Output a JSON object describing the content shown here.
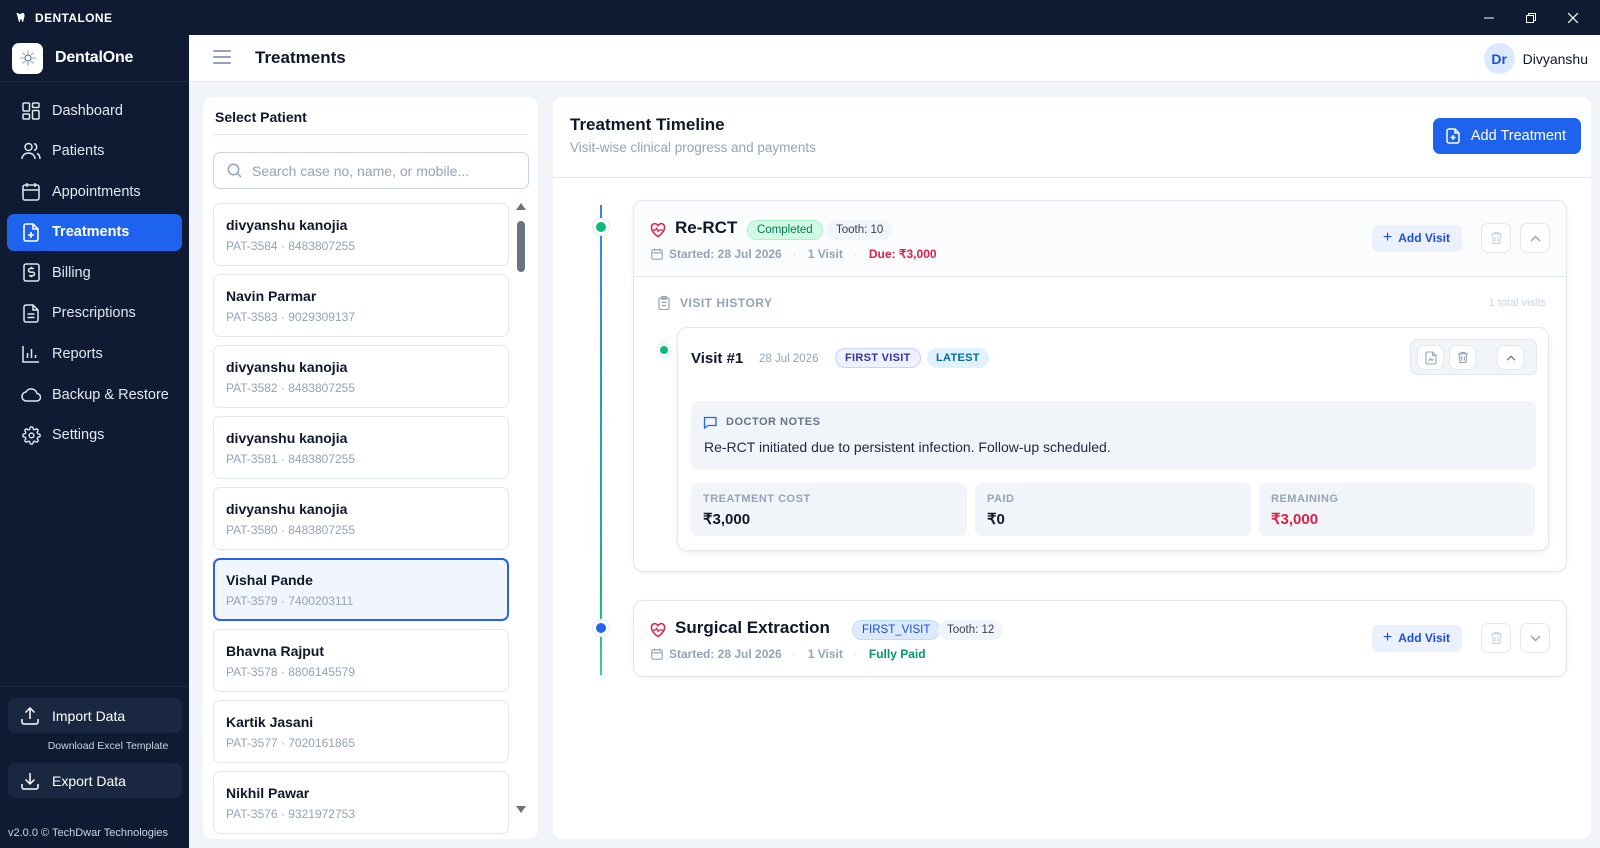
{
  "window": {
    "title": "DENTALONE",
    "controls": [
      "minimize-icon",
      "restore-icon",
      "close-icon"
    ]
  },
  "sidebar": {
    "brand": "DentalOne",
    "items": [
      {
        "label": "Dashboard",
        "icon": "dashboard-icon"
      },
      {
        "label": "Patients",
        "icon": "users-icon"
      },
      {
        "label": "Appointments",
        "icon": "calendar-icon"
      },
      {
        "label": "Treatments",
        "icon": "file-plus-icon",
        "active": true
      },
      {
        "label": "Billing",
        "icon": "billing-icon"
      },
      {
        "label": "Prescriptions",
        "icon": "document-icon"
      },
      {
        "label": "Reports",
        "icon": "bar-chart-icon"
      },
      {
        "label": "Backup & Restore",
        "icon": "cloud-icon"
      },
      {
        "label": "Settings",
        "icon": "gear-icon"
      }
    ],
    "import_label": "Import Data",
    "download_template": "Download Excel Template",
    "export_label": "Export Data",
    "version": "v2.0.0 © TechDwar Technologies"
  },
  "header": {
    "title": "Treatments",
    "user_initials": "Dr",
    "user_name": "Divyanshu"
  },
  "patients": {
    "title": "Select Patient",
    "search_placeholder": "Search case no, name, or mobile...",
    "items": [
      {
        "name": "divyanshu kanojia",
        "meta": "PAT-3584 · 8483807255"
      },
      {
        "name": "Navin Parmar",
        "meta": "PAT-3583 · 9029309137"
      },
      {
        "name": "divyanshu kanojia",
        "meta": "PAT-3582 · 8483807255"
      },
      {
        "name": "divyanshu kanojia",
        "meta": "PAT-3581 · 8483807255"
      },
      {
        "name": "divyanshu kanojia",
        "meta": "PAT-3580 · 8483807255"
      },
      {
        "name": "Vishal Pande",
        "meta": "PAT-3579 · 7400203111",
        "selected": true
      },
      {
        "name": "Bhavna Rajput",
        "meta": "PAT-3578 · 8806145579"
      },
      {
        "name": "Kartik Jasani",
        "meta": "PAT-3577 · 7020161865"
      },
      {
        "name": "Nikhil Pawar",
        "meta": "PAT-3576 · 9321972753"
      }
    ]
  },
  "timeline": {
    "title": "Treatment Timeline",
    "subtitle": "Visit-wise clinical progress and payments",
    "add_treatment": "Add Treatment",
    "treatments": [
      {
        "name": "Re-RCT",
        "status": "Completed",
        "tooth": "Tooth: 10",
        "started": "Started: 28 Jul 2026",
        "visits": "1 Visit",
        "payment": "Due: ₹3,000",
        "add_visit": "Add Visit",
        "visit_history_label": "VISIT HISTORY",
        "total_visits": "1 total visits",
        "visit": {
          "title": "Visit #1",
          "date": "28 Jul 2026",
          "badge_first": "FIRST VISIT",
          "badge_latest": "LATEST",
          "notes_label": "DOCTOR NOTES",
          "notes": "Re-RCT initiated due to persistent infection. Follow-up scheduled.",
          "cost_label": "TREATMENT COST",
          "cost": "₹3,000",
          "paid_label": "PAID",
          "paid": "₹0",
          "remaining_label": "REMAINING",
          "remaining": "₹3,000"
        }
      },
      {
        "name": "Surgical Extraction",
        "status": "FIRST_VISIT",
        "tooth": "Tooth: 12",
        "started": "Started: 28 Jul 2026",
        "visits": "1 Visit",
        "payment": "Fully Paid",
        "add_visit": "Add Visit"
      }
    ]
  },
  "colors": {
    "sidebar_bg": "#0f1b33",
    "accent": "#1d63ed",
    "success": "#10b981",
    "danger": "#e11d48"
  }
}
